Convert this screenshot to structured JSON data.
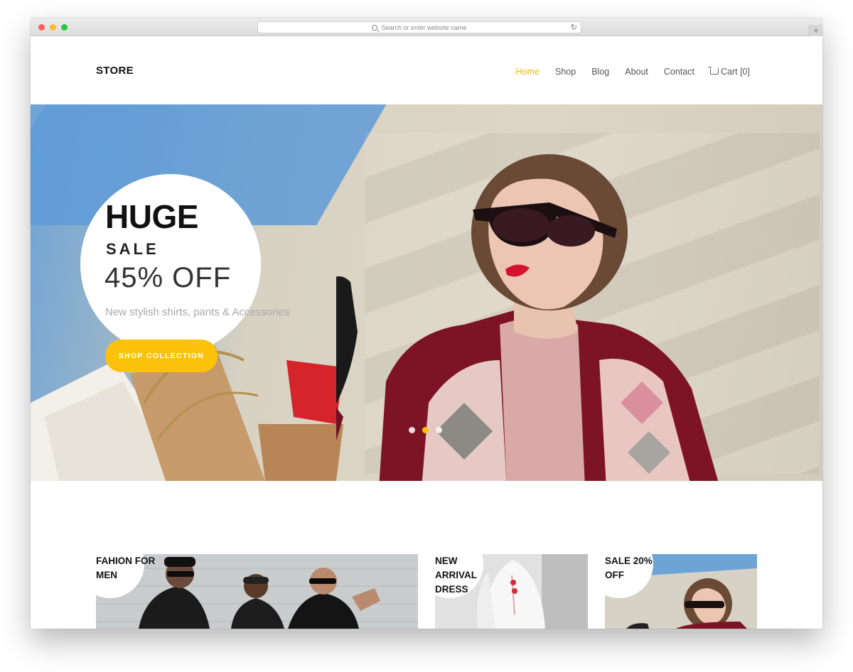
{
  "browser": {
    "url_placeholder": "Search or enter website name",
    "reload_icon": "reload-icon",
    "new_tab_symbol": "+"
  },
  "header": {
    "logo": "STORE",
    "nav": [
      {
        "label": "Home",
        "active": true
      },
      {
        "label": "Shop",
        "active": false
      },
      {
        "label": "Blog",
        "active": false
      },
      {
        "label": "About",
        "active": false
      },
      {
        "label": "Contact",
        "active": false
      }
    ],
    "cart_label": "Cart [0]",
    "cart_icon": "cart-icon"
  },
  "hero": {
    "headline": "HUGE",
    "subheadline": "SALE",
    "discount": "45% OFF",
    "tagline": "New stylish shirts, pants & Accessories",
    "button_label": "SHOP COLLECTION",
    "slider_dots": 3,
    "active_dot": 2
  },
  "categories": [
    {
      "label": "FAHION FOR MEN"
    },
    {
      "label": "NEW ARRIVAL DRESS"
    },
    {
      "label": "SALE 20% OFF"
    }
  ],
  "colors": {
    "accent": "#fcc20b",
    "nav_active": "#f8b400",
    "text_dark": "#111111"
  }
}
